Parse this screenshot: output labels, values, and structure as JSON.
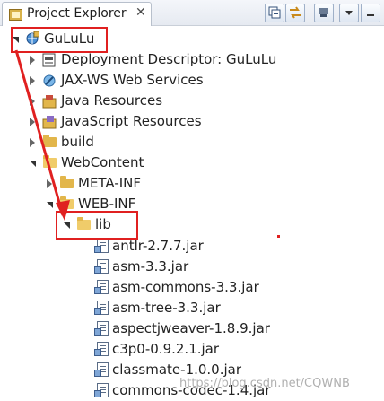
{
  "view": {
    "tab_label": "Project Explorer",
    "close_glyph": "✕"
  },
  "tree": {
    "project": "GuLuLu",
    "items": [
      {
        "label": "Deployment Descriptor: GuLuLu",
        "icon": "descriptor-icon"
      },
      {
        "label": "JAX-WS Web Services",
        "icon": "web-services-icon"
      },
      {
        "label": "Java Resources",
        "icon": "java-resources-icon"
      },
      {
        "label": "JavaScript Resources",
        "icon": "javascript-resources-icon"
      },
      {
        "label": "build",
        "icon": "folder-icon"
      },
      {
        "label": "WebContent",
        "icon": "folder-open-icon"
      },
      {
        "label": "META-INF",
        "icon": "folder-icon"
      },
      {
        "label": "WEB-INF",
        "icon": "folder-open-icon"
      },
      {
        "label": "lib",
        "icon": "folder-open-icon"
      }
    ],
    "jars": [
      "antlr-2.7.7.jar",
      "asm-3.3.jar",
      "asm-commons-3.3.jar",
      "asm-tree-3.3.jar",
      "aspectjweaver-1.8.9.jar",
      "c3p0-0.9.2.1.jar",
      "classmate-1.0.0.jar",
      "commons-codec-1.4.jar"
    ]
  },
  "watermark": "https://blog.csdn.net/CQWNB",
  "colors": {
    "highlight": "#e02020",
    "folder": "#e2b64b"
  }
}
